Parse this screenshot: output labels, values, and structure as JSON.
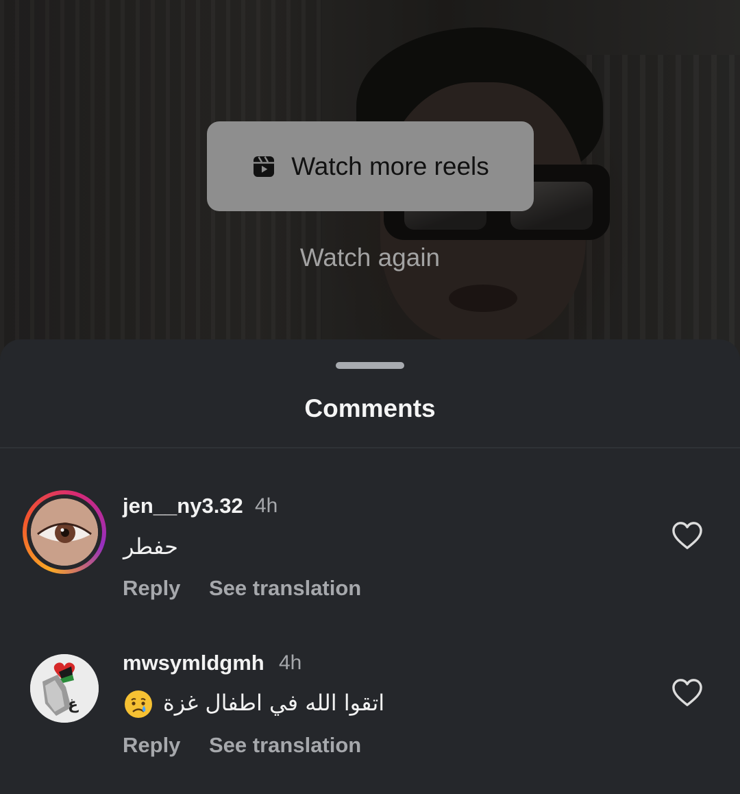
{
  "video": {
    "watch_more_label": "Watch more reels",
    "watch_again_label": "Watch again"
  },
  "sheet": {
    "title": "Comments"
  },
  "comments": [
    {
      "username": "jen__ny3.32",
      "time": "4h",
      "text": "حفطر",
      "reply_label": "Reply",
      "translate_label": "See translation",
      "story_ring": true
    },
    {
      "username": "mwsymldgmh",
      "time": "4h",
      "text": "اتقوا الله في اطفال غزة",
      "emoji": "crying-face",
      "reply_label": "Reply",
      "translate_label": "See translation",
      "story_ring": false
    }
  ],
  "colors": {
    "sheet_background": "#25272b",
    "primary_text": "#f2f2f2",
    "secondary_text": "#a6a8ac",
    "button_background": "#8e8e8e"
  },
  "icons": [
    "reels-icon",
    "heart-icon",
    "crying-face-emoji"
  ]
}
